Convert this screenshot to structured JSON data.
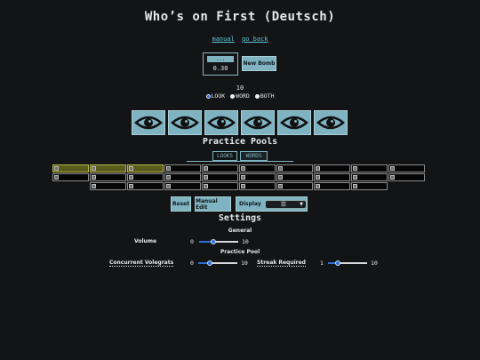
{
  "header": {
    "title": "Who’s on First (Deutsch)"
  },
  "links": {
    "manual": "manual",
    "go_back": "go back"
  },
  "timer": {
    "top": "...",
    "value": "0.30"
  },
  "buttons": {
    "new_bomb": "New Bomb",
    "reset": "Reset",
    "manual_edit": "Manual Edit",
    "display": "Display"
  },
  "count": "10",
  "modes": [
    {
      "label": "LOOK",
      "checked": true
    },
    {
      "label": "WORD",
      "checked": false
    },
    {
      "label": "BOTH",
      "checked": false
    }
  ],
  "eyes": {
    "count": 6,
    "icon": "eye-icon"
  },
  "practice": {
    "title": "Practice Pools",
    "tabs": [
      "LOOKS",
      "WORDS"
    ],
    "rows": [
      {
        "cells": 10,
        "selected": [
          0,
          1,
          2
        ],
        "offset": 0
      },
      {
        "cells": 10,
        "selected": [],
        "offset": 0
      },
      {
        "cells": 8,
        "selected": [],
        "offset": 1
      }
    ]
  },
  "display_select": {
    "value": "☰",
    "icon": "menu-icon"
  },
  "settings": {
    "title": "Settings",
    "general": "General",
    "volume": {
      "label": "Volume",
      "min": "0",
      "max": "10",
      "value": 5
    },
    "pool": "Practice Pool",
    "concurrent": {
      "label": "Concurrent Volegrats",
      "min": "0",
      "max": "10",
      "value": 3
    },
    "streak": {
      "label": "Streak Required",
      "min": "1",
      "max": "10",
      "value": 2
    }
  },
  "colors": {
    "accent": "#7fb3c1",
    "link": "#5fc7d6",
    "background": "#131416",
    "slider": "#2d6fd6"
  }
}
